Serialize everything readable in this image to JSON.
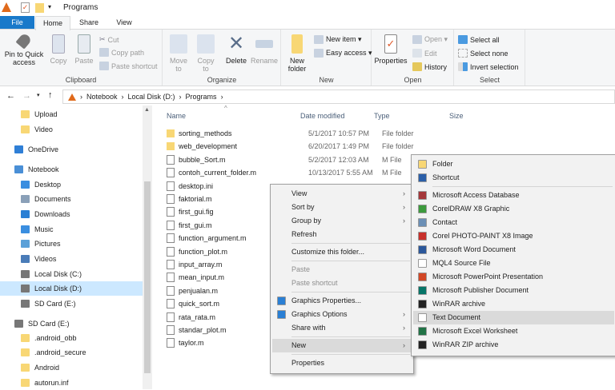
{
  "window": {
    "title": "Programs"
  },
  "tabs": [
    "File",
    "Home",
    "Share",
    "View"
  ],
  "ribbon": {
    "clipboard": {
      "label": "Clipboard",
      "pin": "Pin to Quick access",
      "copy": "Copy",
      "paste": "Paste",
      "cut": "Cut",
      "copy_path": "Copy path",
      "paste_shortcut": "Paste shortcut"
    },
    "organize": {
      "label": "Organize",
      "move_to": "Move to",
      "copy_to": "Copy to",
      "delete": "Delete",
      "rename": "Rename"
    },
    "new": {
      "label": "New",
      "new_folder": "New folder",
      "new_item": "New item ▾",
      "easy_access": "Easy access ▾"
    },
    "open": {
      "label": "Open",
      "properties": "Properties",
      "open": "Open ▾",
      "edit": "Edit",
      "history": "History"
    },
    "select": {
      "label": "Select",
      "select_all": "Select all",
      "select_none": "Select none",
      "invert": "Invert selection"
    }
  },
  "address": {
    "path": [
      "Notebook",
      "Local Disk (D:)",
      "Programs"
    ]
  },
  "nav": [
    {
      "label": "Upload",
      "icon": "folder"
    },
    {
      "label": "Video",
      "icon": "folder"
    },
    {
      "label": "OneDrive",
      "icon": "cloud"
    },
    {
      "label": "Notebook",
      "icon": "pc"
    },
    {
      "label": "Desktop",
      "icon": "desktop"
    },
    {
      "label": "Documents",
      "icon": "docs"
    },
    {
      "label": "Downloads",
      "icon": "download"
    },
    {
      "label": "Music",
      "icon": "music"
    },
    {
      "label": "Pictures",
      "icon": "pictures"
    },
    {
      "label": "Videos",
      "icon": "videos"
    },
    {
      "label": "Local Disk (C:)",
      "icon": "drive"
    },
    {
      "label": "Local Disk (D:)",
      "icon": "drive",
      "selected": true
    },
    {
      "label": "SD Card (E:)",
      "icon": "drive"
    },
    {
      "label": "SD Card (E:)",
      "icon": "drive"
    },
    {
      "label": ".android_obb",
      "icon": "folder"
    },
    {
      "label": ".android_secure",
      "icon": "folder"
    },
    {
      "label": "Android",
      "icon": "folder"
    },
    {
      "label": "autorun.inf",
      "icon": "folder"
    }
  ],
  "columns": [
    "Name",
    "Date modified",
    "Type",
    "Size"
  ],
  "files": [
    {
      "name": "sorting_methods",
      "date": "5/1/2017 10:57 PM",
      "type": "File folder",
      "folder": true
    },
    {
      "name": "web_development",
      "date": "6/20/2017 1:49 PM",
      "type": "File folder",
      "folder": true
    },
    {
      "name": "bubble_Sort.m",
      "date": "5/2/2017 12:03 AM",
      "type": "M File"
    },
    {
      "name": "contoh_current_folder.m",
      "date": "10/13/2017 5:55 AM",
      "type": "M File"
    },
    {
      "name": "desktop.ini",
      "date": "",
      "type": ""
    },
    {
      "name": "faktorial.m",
      "date": "",
      "type": ""
    },
    {
      "name": "first_gui.fig",
      "date": "",
      "type": ""
    },
    {
      "name": "first_gui.m",
      "date": "",
      "type": ""
    },
    {
      "name": "function_argument.m",
      "date": "",
      "type": ""
    },
    {
      "name": "function_plot.m",
      "date": "",
      "type": ""
    },
    {
      "name": "input_array.m",
      "date": "",
      "type": ""
    },
    {
      "name": "mean_input.m",
      "date": "",
      "type": ""
    },
    {
      "name": "penjualan.m",
      "date": "",
      "type": ""
    },
    {
      "name": "quick_sort.m",
      "date": "",
      "type": ""
    },
    {
      "name": "rata_rata.m",
      "date": "",
      "type": ""
    },
    {
      "name": "standar_plot.m",
      "date": "",
      "type": ""
    },
    {
      "name": "taylor.m",
      "date": "",
      "type": ""
    }
  ],
  "context_menu": [
    {
      "label": "View",
      "arrow": true
    },
    {
      "label": "Sort by",
      "arrow": true
    },
    {
      "label": "Group by",
      "arrow": true
    },
    {
      "label": "Refresh"
    },
    {
      "sep": true
    },
    {
      "label": "Customize this folder..."
    },
    {
      "sep": true
    },
    {
      "label": "Paste",
      "disabled": true
    },
    {
      "label": "Paste shortcut",
      "disabled": true
    },
    {
      "sep": true
    },
    {
      "label": "Graphics Properties...",
      "icon": "#2a7fd4"
    },
    {
      "label": "Graphics Options",
      "icon": "#2a7fd4",
      "arrow": true
    },
    {
      "label": "Share with",
      "arrow": true
    },
    {
      "sep": true
    },
    {
      "label": "New",
      "arrow": true,
      "hl": true
    },
    {
      "sep": true
    },
    {
      "label": "Properties"
    }
  ],
  "new_submenu": [
    {
      "label": "Folder",
      "icon": "#f8d775"
    },
    {
      "label": "Shortcut",
      "icon": "#2b5fa8"
    },
    {
      "sep": true
    },
    {
      "label": "Microsoft Access Database",
      "icon": "#a4373a"
    },
    {
      "label": "CorelDRAW X8 Graphic",
      "icon": "#3c9a3c"
    },
    {
      "label": "Contact",
      "icon": "#6b8fb5"
    },
    {
      "label": "Corel PHOTO-PAINT X8 Image",
      "icon": "#c8302b"
    },
    {
      "label": "Microsoft Word Document",
      "icon": "#2b579a"
    },
    {
      "label": "MQL4 Source File",
      "icon": "#ffffff"
    },
    {
      "label": "Microsoft PowerPoint Presentation",
      "icon": "#d24726"
    },
    {
      "label": "Microsoft Publisher Document",
      "icon": "#077568"
    },
    {
      "label": "WinRAR archive",
      "icon": "#222222"
    },
    {
      "label": "Text Document",
      "icon": "#ffffff",
      "hl": true
    },
    {
      "label": "Microsoft Excel Worksheet",
      "icon": "#217346"
    },
    {
      "label": "WinRAR ZIP archive",
      "icon": "#222222"
    }
  ]
}
